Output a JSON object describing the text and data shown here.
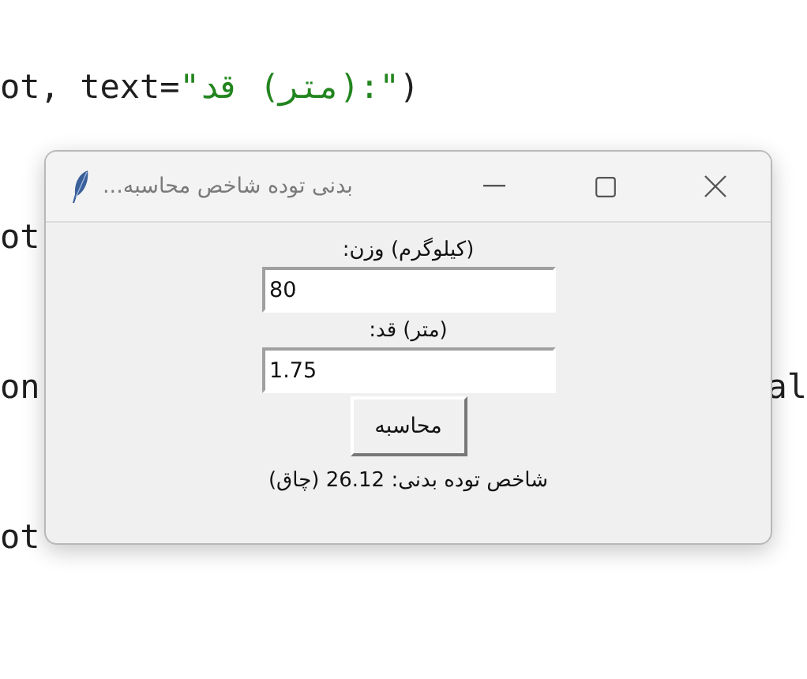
{
  "editor": {
    "lines": [
      {
        "code": "ot, text=",
        "string": "\":(متر) قد\"",
        "code_end": ")"
      },
      {
        "code": "ot"
      },
      {
        "code": "on",
        "right_fragment": "al"
      },
      {
        "code": "ot"
      }
    ]
  },
  "window": {
    "title": "بدنی توده شاخص محاسبه...",
    "controls": [
      {
        "kind": "minimize"
      },
      {
        "kind": "maximize"
      },
      {
        "kind": "close"
      }
    ]
  },
  "form": {
    "fields": [
      {
        "label": "(کیلوگرم) وزن:",
        "value": "80"
      },
      {
        "label": "(متر) قد:",
        "value": "1.75"
      }
    ],
    "button": "محاسبه",
    "result": "شاخص توده بدنی: 26.12 (چاق)"
  }
}
